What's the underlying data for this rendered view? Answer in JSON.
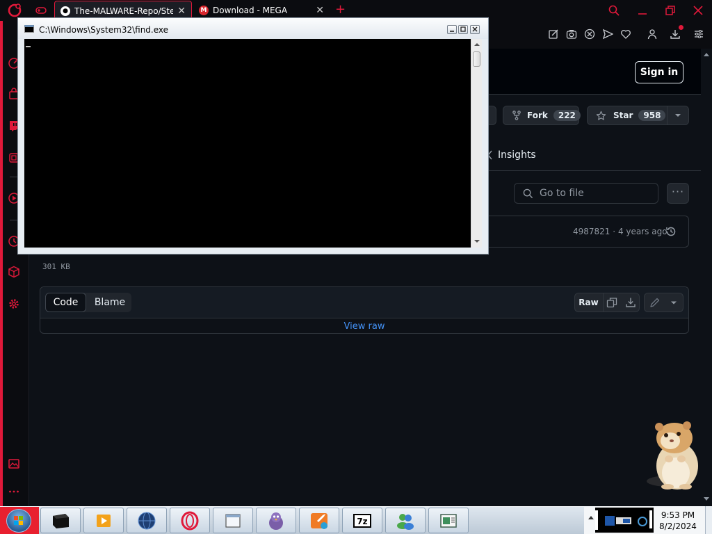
{
  "browser": {
    "tabs": [
      {
        "title": "The-MALWARE-Repo/Steal",
        "favicon": "github-icon",
        "active": true
      },
      {
        "title": "Download - MEGA",
        "favicon": "mega-icon",
        "active": false
      }
    ],
    "new_tab": "+",
    "accent_color": "#e0193a"
  },
  "github": {
    "sign_in": "Sign in",
    "fork": {
      "label": "Fork",
      "count": "222"
    },
    "star": {
      "label": "Star",
      "count": "958"
    },
    "insights": "Insights",
    "go_to_file_placeholder": "Go to file",
    "commit": {
      "hash": "4987821",
      "sep": "·",
      "age": "4 years ago"
    },
    "file_size": "301 KB",
    "tabs": {
      "code": "Code",
      "blame": "Blame"
    },
    "raw": "Raw",
    "view_raw": "View raw"
  },
  "console": {
    "title": "C:\\Windows\\System32\\find.exe"
  },
  "taskbar": {
    "time": "9:53 PM",
    "date": "8/2/2024"
  }
}
